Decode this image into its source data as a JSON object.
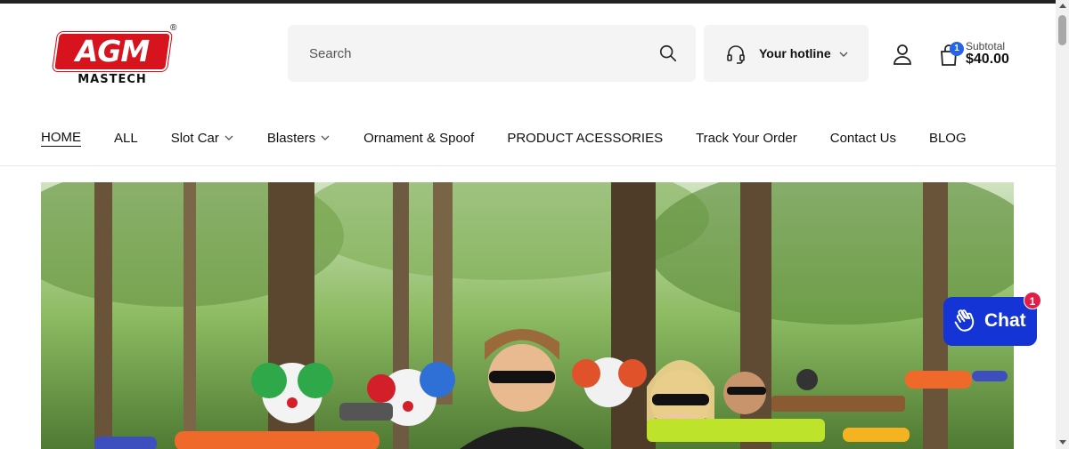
{
  "brand": {
    "logo_main": "AGM",
    "logo_sub": "MASTECH",
    "logo_mark": "®"
  },
  "search": {
    "placeholder": "Search",
    "icon": "search-icon"
  },
  "hotline": {
    "label": "Your hotline",
    "icon": "headset-icon"
  },
  "account": {
    "icon": "user-icon"
  },
  "cart": {
    "icon": "shopping-bag-icon",
    "count": "1",
    "subtotal_label": "Subtotal",
    "subtotal_amount": "$40.00"
  },
  "nav": {
    "items": [
      {
        "label": "HOME"
      },
      {
        "label": "ALL"
      },
      {
        "label": "Slot Car"
      },
      {
        "label": "Blasters"
      },
      {
        "label": "Ornament & Spoof"
      },
      {
        "label": "PRODUCT ACESSORIES"
      },
      {
        "label": "Track Your Order"
      },
      {
        "label": "Contact Us"
      },
      {
        "label": "BLOG"
      }
    ]
  },
  "chat": {
    "label": "Chat",
    "badge": "1",
    "icon": "waving-hand-icon"
  },
  "colors": {
    "brand_red": "#d7141e",
    "chat_blue": "#1434d6",
    "cart_badge": "#2563eb",
    "chat_badge": "#e11d48"
  }
}
